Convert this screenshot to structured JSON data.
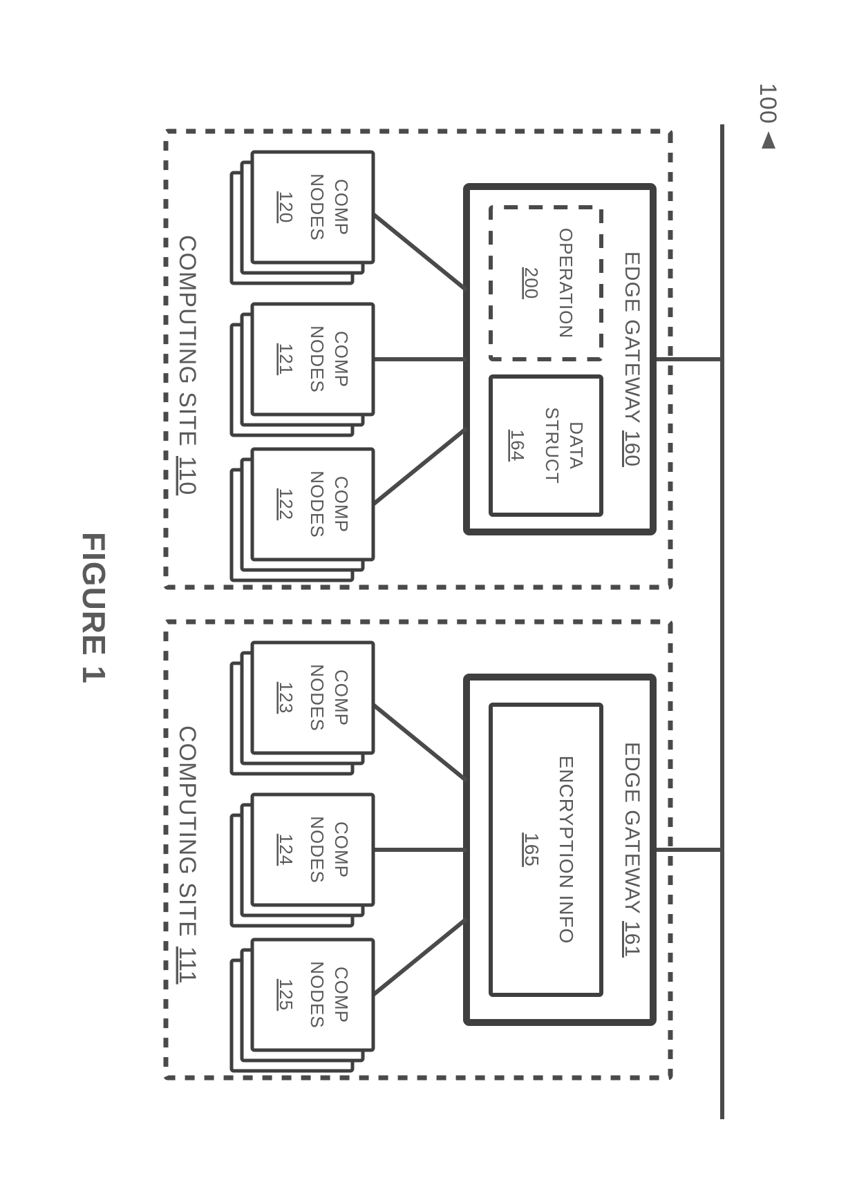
{
  "figure": {
    "id_label": "100",
    "caption": "FIGURE 1"
  },
  "sites": [
    {
      "label": "COMPUTING SITE",
      "ref": "110",
      "gateway": {
        "label": "EDGE GATEWAY",
        "ref": "160",
        "blocks": [
          {
            "label_line1": "OPERATION",
            "label_line2": "",
            "ref": "200",
            "style": "dashed"
          },
          {
            "label_line1": "DATA",
            "label_line2": "STRUCT",
            "ref": "164",
            "style": "solid"
          }
        ]
      },
      "node_groups": [
        {
          "label_line1": "COMP",
          "label_line2": "NODES",
          "ref": "120"
        },
        {
          "label_line1": "COMP",
          "label_line2": "NODES",
          "ref": "121"
        },
        {
          "label_line1": "COMP",
          "label_line2": "NODES",
          "ref": "122"
        }
      ]
    },
    {
      "label": "COMPUTING SITE",
      "ref": "111",
      "gateway": {
        "label": "EDGE GATEWAY",
        "ref": "161",
        "blocks": [
          {
            "label_line1": "ENCRYPTION INFO",
            "label_line2": "",
            "ref": "165",
            "style": "solid"
          }
        ]
      },
      "node_groups": [
        {
          "label_line1": "COMP",
          "label_line2": "NODES",
          "ref": "123"
        },
        {
          "label_line1": "COMP",
          "label_line2": "NODES",
          "ref": "124"
        },
        {
          "label_line1": "COMP",
          "label_line2": "NODES",
          "ref": "125"
        }
      ]
    }
  ]
}
